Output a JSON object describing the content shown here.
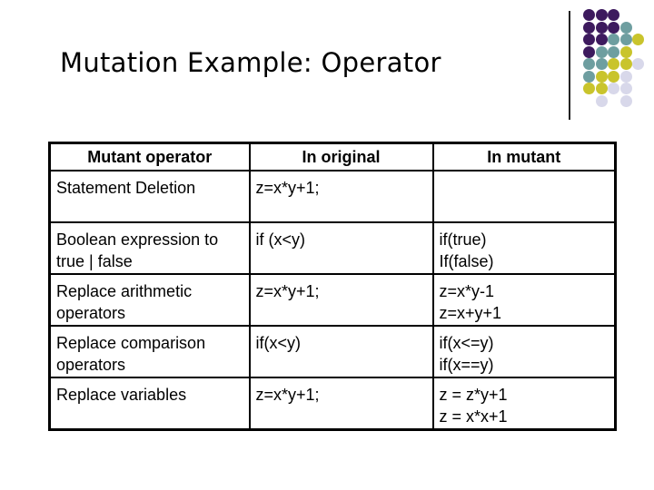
{
  "slide": {
    "title": "Mutation Example: Operator",
    "decoration": {
      "colors": {
        "purple": "#3d1a5e",
        "teal": "#6e9ea0",
        "olive": "#c9c42c",
        "lavender": "#d8d8ea"
      }
    }
  },
  "table": {
    "headers": [
      "Mutant operator",
      "In original",
      "In mutant"
    ],
    "rows": [
      {
        "operator": [
          "Statement Deletion"
        ],
        "original": [
          "z=x*y+1;"
        ],
        "mutant": []
      },
      {
        "operator": [
          "Boolean expression to",
          "true | false"
        ],
        "original": [
          "if (x<y)"
        ],
        "mutant": [
          "if(true)",
          "If(false)"
        ]
      },
      {
        "operator": [
          "Replace arithmetic",
          "operators"
        ],
        "original": [
          "z=x*y+1;"
        ],
        "mutant": [
          "z=x*y-1",
          "z=x+y+1"
        ]
      },
      {
        "operator": [
          "Replace comparison",
          "operators"
        ],
        "original": [
          "if(x<y)"
        ],
        "mutant": [
          "if(x<=y)",
          "if(x==y)"
        ]
      },
      {
        "operator": [
          "Replace variables"
        ],
        "original": [
          "z=x*y+1;"
        ],
        "mutant": [
          "z = z*y+1",
          "z = x*x+1"
        ]
      }
    ]
  }
}
